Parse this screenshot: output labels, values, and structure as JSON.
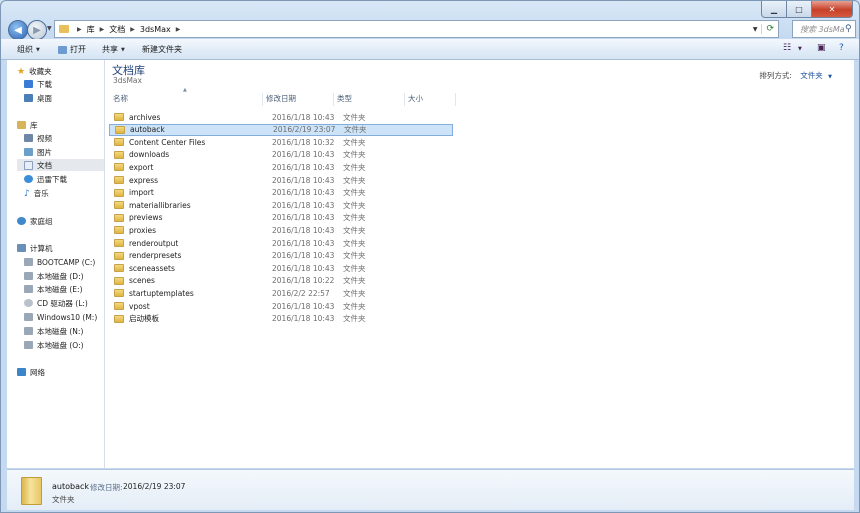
{
  "address": {
    "segments": [
      "库",
      "文档",
      "3dsMax"
    ],
    "search_placeholder": "搜索 3dsMax"
  },
  "toolbar": {
    "organize": "组织",
    "open": "打开",
    "share": "共享",
    "new_folder": "新建文件夹"
  },
  "nav": {
    "favorites": "收藏夹",
    "downloads": "下载",
    "desktop": "桌面",
    "libraries": "库",
    "videos": "视频",
    "pictures": "图片",
    "documents": "文档",
    "xunlei": "迅雷下载",
    "music": "音乐",
    "homegroup": "家庭组",
    "computer": "计算机",
    "drives": [
      "BOOTCAMP (C:)",
      "本地磁盘 (D:)",
      "本地磁盘 (E:)",
      "CD 驱动器 (L:)",
      "Windows10 (M:)",
      "本地磁盘 (N:)",
      "本地磁盘 (O:)"
    ],
    "network": "网络"
  },
  "library": {
    "title": "文档库",
    "subtitle": "3dsMax",
    "arrange_label": "排列方式:",
    "arrange_value": "文件夹"
  },
  "columns": {
    "name": "名称",
    "date": "修改日期",
    "type": "类型",
    "size": "大小"
  },
  "files": [
    {
      "name": "archives",
      "date": "2016/1/18 10:43",
      "type": "文件夹"
    },
    {
      "name": "autoback",
      "date": "2016/2/19 23:07",
      "type": "文件夹"
    },
    {
      "name": "Content Center Files",
      "date": "2016/1/18 10:32",
      "type": "文件夹"
    },
    {
      "name": "downloads",
      "date": "2016/1/18 10:43",
      "type": "文件夹"
    },
    {
      "name": "export",
      "date": "2016/1/18 10:43",
      "type": "文件夹"
    },
    {
      "name": "express",
      "date": "2016/1/18 10:43",
      "type": "文件夹"
    },
    {
      "name": "import",
      "date": "2016/1/18 10:43",
      "type": "文件夹"
    },
    {
      "name": "materiallibraries",
      "date": "2016/1/18 10:43",
      "type": "文件夹"
    },
    {
      "name": "previews",
      "date": "2016/1/18 10:43",
      "type": "文件夹"
    },
    {
      "name": "proxies",
      "date": "2016/1/18 10:43",
      "type": "文件夹"
    },
    {
      "name": "renderoutput",
      "date": "2016/1/18 10:43",
      "type": "文件夹"
    },
    {
      "name": "renderpresets",
      "date": "2016/1/18 10:43",
      "type": "文件夹"
    },
    {
      "name": "sceneassets",
      "date": "2016/1/18 10:43",
      "type": "文件夹"
    },
    {
      "name": "scenes",
      "date": "2016/1/18 10:22",
      "type": "文件夹"
    },
    {
      "name": "startuptemplates",
      "date": "2016/2/2 22:57",
      "type": "文件夹"
    },
    {
      "name": "vpost",
      "date": "2016/1/18 10:43",
      "type": "文件夹"
    },
    {
      "name": "启动模板",
      "date": "2016/1/18 10:43",
      "type": "文件夹"
    }
  ],
  "details": {
    "name": "autoback",
    "date_label": "修改日期:",
    "date": "2016/2/19 23:07",
    "type": "文件夹"
  }
}
